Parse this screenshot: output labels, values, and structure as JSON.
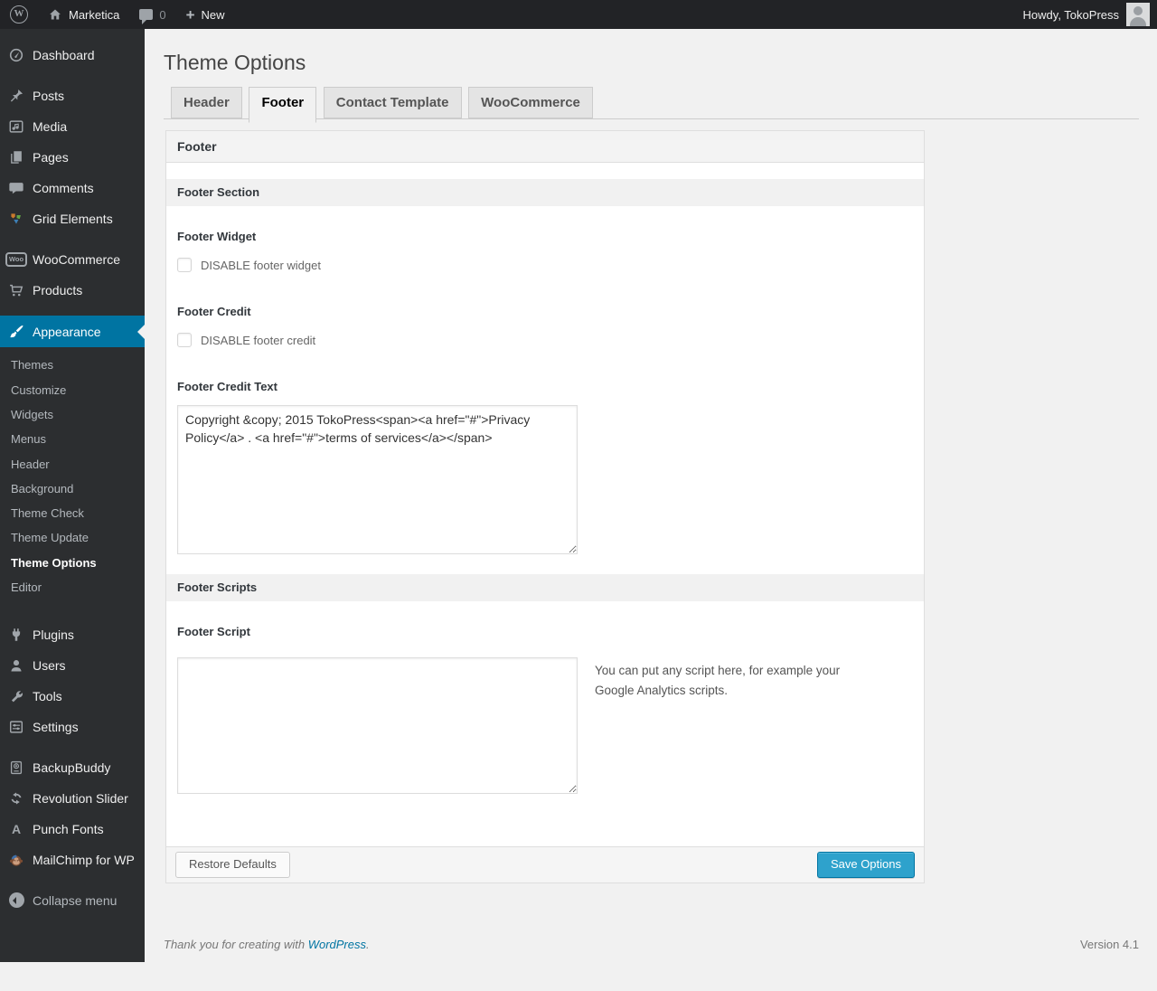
{
  "admin_bar": {
    "site_name": "Marketica",
    "comments_count": "0",
    "new_label": "New",
    "howdy_text": "Howdy, TokoPress"
  },
  "sidebar": {
    "items": [
      "Dashboard",
      "Posts",
      "Media",
      "Pages",
      "Comments",
      "Grid Elements",
      "WooCommerce",
      "Products",
      "Appearance",
      "Plugins",
      "Users",
      "Tools",
      "Settings",
      "BackupBuddy",
      "Revolution Slider",
      "Punch Fonts",
      "MailChimp for WP",
      "Collapse menu"
    ],
    "submenu": [
      "Themes",
      "Customize",
      "Widgets",
      "Menus",
      "Header",
      "Background",
      "Theme Check",
      "Theme Update",
      "Theme Options",
      "Editor"
    ],
    "woo_badge": "Woo",
    "punch_fonts_glyph": "A",
    "active_item": "Appearance",
    "active_submenu_item": "Theme Options"
  },
  "page": {
    "title": "Theme Options",
    "tabs": [
      "Header",
      "Footer",
      "Contact Template",
      "WooCommerce"
    ],
    "active_tab": "Footer"
  },
  "panel": {
    "group_title": "Footer",
    "section_footer_title": "Footer Section",
    "footer_widget": {
      "label": "Footer Widget",
      "checkbox_label": "DISABLE footer widget",
      "checked": false
    },
    "footer_credit": {
      "label": "Footer Credit",
      "checkbox_label": "DISABLE footer credit",
      "checked": false
    },
    "footer_credit_text": {
      "label": "Footer Credit Text",
      "value": "Copyright &copy; 2015 TokoPress<span><a href=\"#\">Privacy Policy</a> . <a href=\"#\">terms of services</a></span>"
    },
    "section_scripts_title": "Footer Scripts",
    "footer_script": {
      "label": "Footer Script",
      "value": "",
      "help": "You can put any script here, for example your Google Analytics scripts."
    },
    "restore_button": "Restore Defaults",
    "save_button": "Save Options"
  },
  "page_footer": {
    "thanks_text": "Thank you for creating with",
    "wordpress_link": "WordPress",
    "period": ".",
    "version": "Version 4.1"
  },
  "colors": {
    "accent": "#0074a2",
    "primary_button": "#2ea2cc",
    "admin_bar_bg": "#222326",
    "sidebar_bg": "#2c2e30",
    "page_bg": "#f1f1f1"
  }
}
